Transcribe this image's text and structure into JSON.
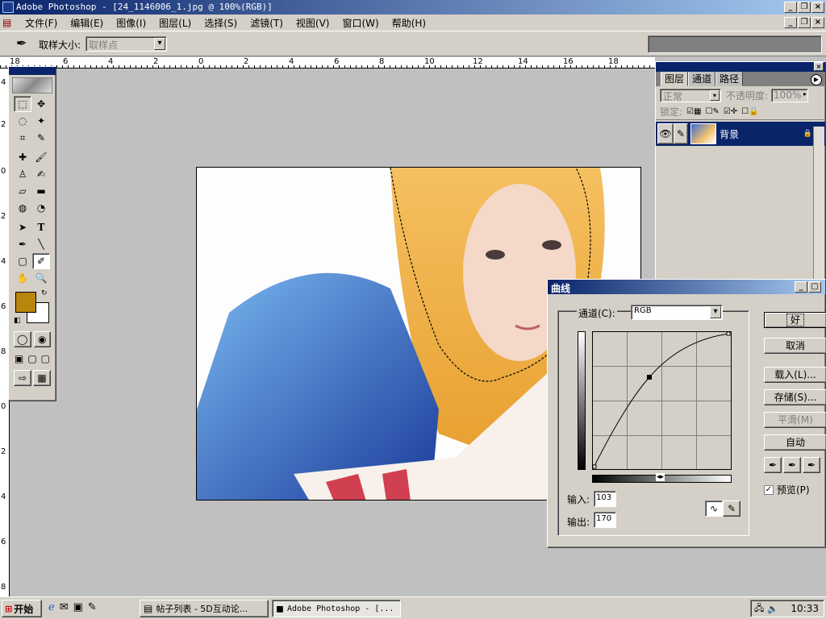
{
  "app": {
    "title": "Adobe Photoshop - [24_1146006_1.jpg @ 100%(RGB)]"
  },
  "menu": [
    "文件(F)",
    "编辑(E)",
    "图像(I)",
    "图层(L)",
    "选择(S)",
    "滤镜(T)",
    "视图(V)",
    "窗口(W)",
    "帮助(H)"
  ],
  "options": {
    "sample_label": "取样大小:",
    "sample_value": "取样点"
  },
  "ruler": {
    "top": [
      "18",
      "6",
      "4",
      "2",
      "0",
      "2",
      "4",
      "6",
      "8",
      "10",
      "12",
      "14",
      "16",
      "18"
    ],
    "left": [
      "4",
      "2",
      "0",
      "2",
      "4",
      "6",
      "8",
      "0",
      "2",
      "4",
      "6",
      "8"
    ]
  },
  "layers": {
    "tabs": [
      "图层",
      "通道",
      "路径"
    ],
    "blend": "正常",
    "opacity_label": "不透明度:",
    "opacity": "100%",
    "lock_label": "锁定:",
    "layer_name": "背景"
  },
  "curves": {
    "title": "曲线",
    "channel_label": "通道(C):",
    "channel": "RGB",
    "input_label": "输入:",
    "input": "103",
    "output_label": "输出:",
    "output": "170",
    "ok": "好",
    "cancel": "取消",
    "load": "载入(L)...",
    "save": "存储(S)...",
    "smooth": "平滑(M)",
    "auto": "自动",
    "preview": "预览(P)"
  },
  "taskbar": {
    "start": "开始",
    "task1": "帖子列表 - 5D互动论...",
    "task2": "Adobe Photoshop - [...",
    "clock": "10:33"
  },
  "colors": {
    "fg": "#b8860b",
    "bg": "#ffffff"
  }
}
